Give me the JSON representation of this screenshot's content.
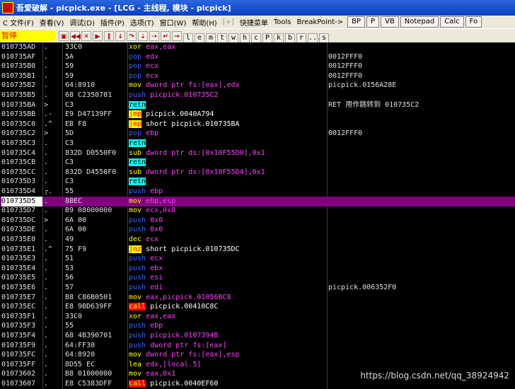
{
  "title": "吾爱破解 - picpick.exe - [LCG - 主线程, 模块 - picpick]",
  "menu": [
    {
      "label": "C 文件(F)",
      "dim": false
    },
    {
      "label": "查看(V)",
      "dim": false
    },
    {
      "label": "调试(D)",
      "dim": false
    },
    {
      "label": "插件(P)",
      "dim": false
    },
    {
      "label": "选项(T)",
      "dim": false
    },
    {
      "label": "窗口(W)",
      "dim": false
    },
    {
      "label": "帮助(H)",
      "dim": false
    },
    {
      "label": "[+]",
      "dim": true
    },
    {
      "label": "快捷菜单",
      "dim": false
    },
    {
      "label": "Tools",
      "dim": false
    },
    {
      "label": "BreakPoint->",
      "dim": false
    }
  ],
  "menu_buttons": [
    "BP",
    "P",
    "VB",
    "Notepad",
    "Calc",
    "Fo"
  ],
  "status": "暂停",
  "toolbar_letters": [
    "l",
    "e",
    "m",
    "t",
    "w",
    "h",
    "c",
    "P",
    "k",
    "b",
    "r",
    "...",
    "s"
  ],
  "rows": [
    {
      "addr": "010735AD",
      "mark": ".",
      "hex": "33C0",
      "op": "xor",
      "args": "eax,eax",
      "cls": "hl-xor",
      "comment": ""
    },
    {
      "addr": "010735AF",
      "mark": ".",
      "hex": "5A",
      "op": "pop",
      "args": "edx",
      "cls": "hl-pop",
      "comment": "0012FFF0"
    },
    {
      "addr": "010735B0",
      "mark": ".",
      "hex": "59",
      "op": "pop",
      "args": "ecx",
      "cls": "hl-pop",
      "comment": "0012FFF0"
    },
    {
      "addr": "010735B1",
      "mark": ".",
      "hex": "59",
      "op": "pop",
      "args": "ecx",
      "cls": "hl-pop",
      "comment": "0012FFF0"
    },
    {
      "addr": "010735B2",
      "mark": ".",
      "hex": "64:8910",
      "op": "mov",
      "args": "dword ptr fs:[eax],edx",
      "cls": "hl-mov",
      "comment": "picpick.0156A28E"
    },
    {
      "addr": "010735B5",
      "mark": ".",
      "hex": "68 C2350701",
      "op": "push",
      "args": "picpick.010735C2",
      "cls": "hl-push",
      "comment": ""
    },
    {
      "addr": "010735BA",
      "mark": ">",
      "hex": "C3",
      "op": "retn",
      "args": "",
      "cls": "hl-cyan",
      "comment": "RET 用作跳转到 010735C2"
    },
    {
      "addr": "010735BB",
      "mark": ".-",
      "hex": "E9 D47139FF",
      "op": "jmp",
      "args": "picpick.0040A794",
      "cls": "hl-yellow",
      "comment": ""
    },
    {
      "addr": "010735C0",
      "mark": ".^",
      "hex": "EB F8",
      "op": "jmp",
      "args": "short picpick.010735BA",
      "cls": "hl-yellow",
      "comment": ""
    },
    {
      "addr": "010735C2",
      "mark": ">",
      "hex": "5D",
      "op": "pop",
      "args": "ebp",
      "cls": "hl-pop",
      "comment": "0012FFF0"
    },
    {
      "addr": "010735C3",
      "mark": ".",
      "hex": "C3",
      "op": "retn",
      "args": "",
      "cls": "hl-cyan",
      "comment": ""
    },
    {
      "addr": "010735C4",
      "mark": ".",
      "hex": "832D D0550F0",
      "op": "sub",
      "args": "dword ptr ds:[0x10F55D0],0x1",
      "cls": "hl-sub",
      "comment": ""
    },
    {
      "addr": "010735CB",
      "mark": ".",
      "hex": "C3",
      "op": "retn",
      "args": "",
      "cls": "hl-cyan",
      "comment": ""
    },
    {
      "addr": "010735CC",
      "mark": ".",
      "hex": "832D D4550F0",
      "op": "sub",
      "args": "dword ptr ds:[0x10F55D4],0x1",
      "cls": "hl-sub",
      "comment": ""
    },
    {
      "addr": "010735D3",
      "mark": ".",
      "hex": "C3",
      "op": "retn",
      "args": "",
      "cls": "hl-cyan",
      "comment": ""
    },
    {
      "addr": "010735D4",
      "mark": "┌.",
      "hex": "55",
      "op": "push",
      "args": "ebp",
      "cls": "hl-push",
      "comment": ""
    },
    {
      "addr": "010735D5",
      "mark": ".",
      "hex": "8BEC",
      "op": "mov",
      "args": "ebp,esp",
      "cls": "hl-mov",
      "comment": "",
      "sel": true
    },
    {
      "addr": "010735D7",
      "mark": ".",
      "hex": "B9 08000000",
      "op": "mov",
      "args": "ecx,0x8",
      "cls": "hl-mov",
      "comment": ""
    },
    {
      "addr": "010735DC",
      "mark": ">",
      "hex": "6A 00",
      "op": "push",
      "args": "0x0",
      "cls": "hl-push",
      "comment": ""
    },
    {
      "addr": "010735DE",
      "mark": ".",
      "hex": "6A 00",
      "op": "push",
      "args": "0x0",
      "cls": "hl-push",
      "comment": ""
    },
    {
      "addr": "010735E0",
      "mark": ".",
      "hex": "49",
      "op": "dec",
      "args": "ecx",
      "cls": "hl-dec",
      "comment": ""
    },
    {
      "addr": "010735E1",
      "mark": ".^",
      "hex": "75 F9",
      "op": "jnz",
      "args": "short picpick.010735DC",
      "cls": "hl-yellow",
      "comment": ""
    },
    {
      "addr": "010735E3",
      "mark": ".",
      "hex": "51",
      "op": "push",
      "args": "ecx",
      "cls": "hl-push",
      "comment": ""
    },
    {
      "addr": "010735E4",
      "mark": ".",
      "hex": "53",
      "op": "push",
      "args": "ebx",
      "cls": "hl-push",
      "comment": ""
    },
    {
      "addr": "010735E5",
      "mark": ".",
      "hex": "56",
      "op": "push",
      "args": "esi",
      "cls": "hl-push",
      "comment": ""
    },
    {
      "addr": "010735E6",
      "mark": ".",
      "hex": "57",
      "op": "push",
      "args": "edi",
      "cls": "hl-push",
      "comment": "picpick.006352F0"
    },
    {
      "addr": "010735E7",
      "mark": ".",
      "hex": "B8 C86B0501",
      "op": "mov",
      "args": "eax,picpick.01056BC8",
      "cls": "hl-mov",
      "comment": ""
    },
    {
      "addr": "010735EC",
      "mark": ".",
      "hex": "E8 9BD639FF",
      "op": "call",
      "args": "picpick.00410C8C",
      "cls": "hl-red",
      "comment": ""
    },
    {
      "addr": "010735F1",
      "mark": ".",
      "hex": "33C0",
      "op": "xor",
      "args": "eax,eax",
      "cls": "hl-xor",
      "comment": ""
    },
    {
      "addr": "010735F3",
      "mark": ".",
      "hex": "55",
      "op": "push",
      "args": "ebp",
      "cls": "hl-push",
      "comment": ""
    },
    {
      "addr": "010735F4",
      "mark": ".",
      "hex": "68 4B390701",
      "op": "push",
      "args": "picpick.0107394B",
      "cls": "hl-push",
      "comment": ""
    },
    {
      "addr": "010735F9",
      "mark": ".",
      "hex": "64:FF30",
      "op": "push",
      "args": "dword ptr fs:[eax]",
      "cls": "hl-push",
      "comment": ""
    },
    {
      "addr": "010735FC",
      "mark": ".",
      "hex": "64:8920",
      "op": "mov",
      "args": "dword ptr fs:[eax],esp",
      "cls": "hl-mov",
      "comment": ""
    },
    {
      "addr": "010735FF",
      "mark": ".",
      "hex": "8D55 EC",
      "op": "lea",
      "args": "edx,[local.5]",
      "cls": "hl-lea",
      "comment": ""
    },
    {
      "addr": "01073602",
      "mark": ".",
      "hex": "B8 01000000",
      "op": "mov",
      "args": "eax,0x1",
      "cls": "hl-mov",
      "comment": ""
    },
    {
      "addr": "01073607",
      "mark": ".",
      "hex": "E8 C5383DFF",
      "op": "call",
      "args": "picpick.0040EF60",
      "cls": "hl-red",
      "comment": ""
    }
  ],
  "watermark": "https://blog.csdn.net/qq_38924942"
}
